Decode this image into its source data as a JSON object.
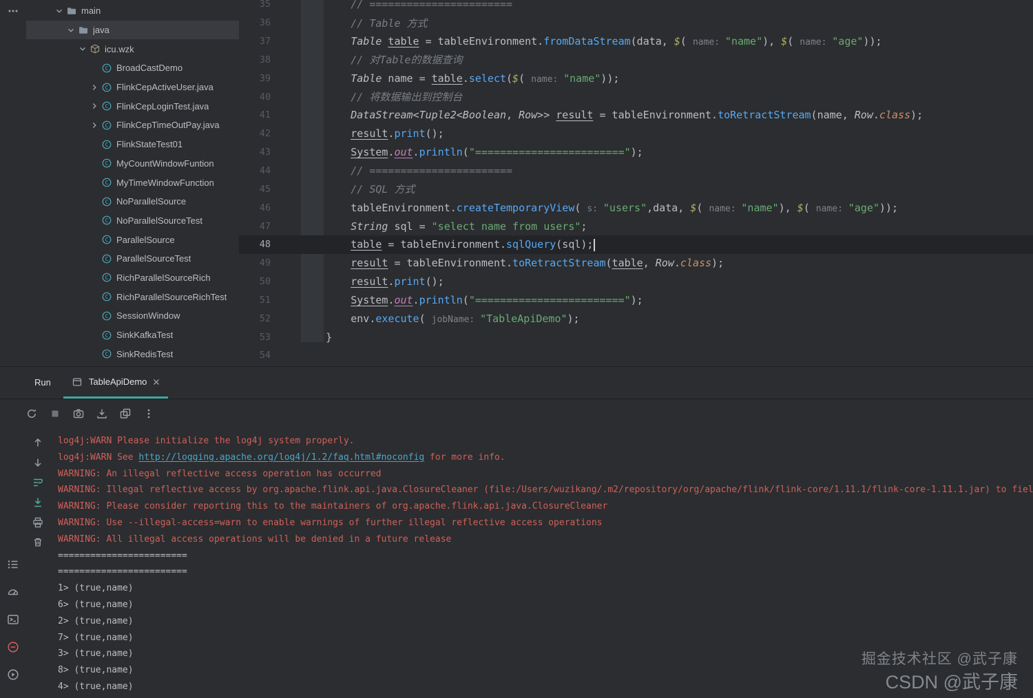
{
  "colors": {
    "background": "#2B2D30",
    "divider": "#1E1F22",
    "selection_bg": "#393B40",
    "caret_line_bg": "#222428",
    "accent_teal": "#3FA99F",
    "stderr_red": "#D0605A",
    "stdout_gray": "#BCBEC4",
    "link_blue": "#4BA6C9",
    "string_green": "#6AAB73",
    "method_blue": "#57A8F5",
    "keyword_orange": "#CF8E6D",
    "comment_gray": "#7A7E85",
    "static_field_purple": "#C77DBB",
    "class_icon_teal": "#4BA8B8",
    "problems_red": "#DB5C5C"
  },
  "left_strip": {
    "top_icons": [
      {
        "name": "more-tool-windows-icon"
      }
    ],
    "bottom_icons": [
      {
        "name": "structure-icon"
      },
      {
        "name": "profiler-icon"
      },
      {
        "name": "terminal-icon"
      },
      {
        "name": "problems-icon"
      },
      {
        "name": "services-icon"
      }
    ]
  },
  "project_tree": {
    "items": [
      {
        "label": "main",
        "type": "folder",
        "depth": 0,
        "chevron": "down"
      },
      {
        "label": "java",
        "type": "folder",
        "depth": 1,
        "chevron": "down",
        "selected": true
      },
      {
        "label": "icu.wzk",
        "type": "package",
        "depth": 2,
        "chevron": "down"
      },
      {
        "label": "BroadCastDemo",
        "type": "class",
        "depth": 3
      },
      {
        "label": "FlinkCepActiveUser.java",
        "type": "class",
        "depth": 3,
        "chevron": "right"
      },
      {
        "label": "FlinkCepLoginTest.java",
        "type": "class",
        "depth": 3,
        "chevron": "right"
      },
      {
        "label": "FlinkCepTimeOutPay.java",
        "type": "class",
        "depth": 3,
        "chevron": "right"
      },
      {
        "label": "FlinkStateTest01",
        "type": "class",
        "depth": 3
      },
      {
        "label": "MyCountWindowFuntion",
        "type": "class",
        "depth": 3
      },
      {
        "label": "MyTimeWindowFunction",
        "type": "class",
        "depth": 3
      },
      {
        "label": "NoParallelSource",
        "type": "class",
        "depth": 3
      },
      {
        "label": "NoParallelSourceTest",
        "type": "class",
        "depth": 3
      },
      {
        "label": "ParallelSource",
        "type": "class",
        "depth": 3
      },
      {
        "label": "ParallelSourceTest",
        "type": "class",
        "depth": 3
      },
      {
        "label": "RichParallelSourceRich",
        "type": "class",
        "depth": 3
      },
      {
        "label": "RichParallelSourceRichTest",
        "type": "class",
        "depth": 3
      },
      {
        "label": "SessionWindow",
        "type": "class",
        "depth": 3
      },
      {
        "label": "SinkKafkaTest",
        "type": "class",
        "depth": 3
      },
      {
        "label": "SinkRedisTest",
        "type": "class",
        "depth": 3
      }
    ]
  },
  "editor": {
    "current_line": 48,
    "lines": [
      {
        "num": 35,
        "ind": 8,
        "tokens": [
          {
            "t": "// =======================",
            "s": "cmt"
          }
        ]
      },
      {
        "num": 36,
        "ind": 8,
        "tokens": [
          {
            "t": "// Table 方式",
            "s": "cmt"
          }
        ]
      },
      {
        "num": 37,
        "ind": 8,
        "tokens": [
          {
            "t": "Table",
            "s": "typ"
          },
          {
            "t": " ",
            "s": "id"
          },
          {
            "t": "table",
            "s": "und"
          },
          {
            "t": " = ",
            "s": "id"
          },
          {
            "t": "tableEnvironment.",
            "s": "id"
          },
          {
            "t": "fromDataStream",
            "s": "mth"
          },
          {
            "t": "(",
            "s": "id"
          },
          {
            "t": "data",
            "s": "id"
          },
          {
            "t": ", ",
            "s": "id"
          },
          {
            "t": "$",
            "s": "smth"
          },
          {
            "t": "( ",
            "s": "id"
          },
          {
            "t": "name: ",
            "s": "hint"
          },
          {
            "t": "\"name\"",
            "s": "str"
          },
          {
            "t": "), ",
            "s": "id"
          },
          {
            "t": "$",
            "s": "smth"
          },
          {
            "t": "( ",
            "s": "id"
          },
          {
            "t": "name: ",
            "s": "hint"
          },
          {
            "t": "\"age\"",
            "s": "str"
          },
          {
            "t": "));",
            "s": "id"
          }
        ]
      },
      {
        "num": 38,
        "ind": 8,
        "tokens": [
          {
            "t": "// 对Table的数据查询",
            "s": "cmt"
          }
        ]
      },
      {
        "num": 39,
        "ind": 8,
        "tokens": [
          {
            "t": "Table",
            "s": "typ"
          },
          {
            "t": " name = ",
            "s": "id"
          },
          {
            "t": "table",
            "s": "und"
          },
          {
            "t": ".",
            "s": "id"
          },
          {
            "t": "select",
            "s": "mth"
          },
          {
            "t": "(",
            "s": "id"
          },
          {
            "t": "$",
            "s": "smth"
          },
          {
            "t": "( ",
            "s": "id"
          },
          {
            "t": "name: ",
            "s": "hint"
          },
          {
            "t": "\"name\"",
            "s": "str"
          },
          {
            "t": "));",
            "s": "id"
          }
        ]
      },
      {
        "num": 40,
        "ind": 8,
        "tokens": [
          {
            "t": "// 将数据输出到控制台",
            "s": "cmt"
          }
        ]
      },
      {
        "num": 41,
        "ind": 8,
        "tokens": [
          {
            "t": "DataStream",
            "s": "typ"
          },
          {
            "t": "<",
            "s": "id"
          },
          {
            "t": "Tuple2",
            "s": "typ"
          },
          {
            "t": "<",
            "s": "id"
          },
          {
            "t": "Boolean",
            "s": "typ"
          },
          {
            "t": ", ",
            "s": "id"
          },
          {
            "t": "Row",
            "s": "typ"
          },
          {
            "t": ">> ",
            "s": "id"
          },
          {
            "t": "result",
            "s": "und"
          },
          {
            "t": " = tableEnvironment.",
            "s": "id"
          },
          {
            "t": "toRetractStream",
            "s": "mth"
          },
          {
            "t": "(",
            "s": "id"
          },
          {
            "t": "name",
            "s": "id"
          },
          {
            "t": ", ",
            "s": "id"
          },
          {
            "t": "Row",
            "s": "typ"
          },
          {
            "t": ".",
            "s": "id"
          },
          {
            "t": "class",
            "s": "kw"
          },
          {
            "t": ");",
            "s": "id"
          }
        ]
      },
      {
        "num": 42,
        "ind": 8,
        "tokens": [
          {
            "t": "result",
            "s": "und"
          },
          {
            "t": ".",
            "s": "id"
          },
          {
            "t": "print",
            "s": "mth"
          },
          {
            "t": "();",
            "s": "id"
          }
        ]
      },
      {
        "num": 43,
        "ind": 8,
        "tokens": [
          {
            "t": "System",
            "s": "und"
          },
          {
            "t": ".",
            "s": "id"
          },
          {
            "t": "out",
            "s": "sfld"
          },
          {
            "t": ".",
            "s": "id"
          },
          {
            "t": "println",
            "s": "mth"
          },
          {
            "t": "(",
            "s": "id"
          },
          {
            "t": "\"========================\"",
            "s": "str"
          },
          {
            "t": ");",
            "s": "id"
          }
        ]
      },
      {
        "num": 44,
        "ind": 8,
        "tokens": [
          {
            "t": "// =======================",
            "s": "cmt"
          }
        ]
      },
      {
        "num": 45,
        "ind": 8,
        "tokens": [
          {
            "t": "// SQL 方式",
            "s": "cmt"
          }
        ]
      },
      {
        "num": 46,
        "ind": 8,
        "tokens": [
          {
            "t": "tableEnvironment.",
            "s": "id"
          },
          {
            "t": "createTemporaryView",
            "s": "mth"
          },
          {
            "t": "( ",
            "s": "id"
          },
          {
            "t": "s: ",
            "s": "hint"
          },
          {
            "t": "\"users\"",
            "s": "str"
          },
          {
            "t": ",",
            "s": "id"
          },
          {
            "t": "data",
            "s": "id"
          },
          {
            "t": ", ",
            "s": "id"
          },
          {
            "t": "$",
            "s": "smth"
          },
          {
            "t": "( ",
            "s": "id"
          },
          {
            "t": "name: ",
            "s": "hint"
          },
          {
            "t": "\"name\"",
            "s": "str"
          },
          {
            "t": "), ",
            "s": "id"
          },
          {
            "t": "$",
            "s": "smth"
          },
          {
            "t": "( ",
            "s": "id"
          },
          {
            "t": "name: ",
            "s": "hint"
          },
          {
            "t": "\"age\"",
            "s": "str"
          },
          {
            "t": "));",
            "s": "id"
          }
        ]
      },
      {
        "num": 47,
        "ind": 8,
        "tokens": [
          {
            "t": "String",
            "s": "typ"
          },
          {
            "t": " sql = ",
            "s": "id"
          },
          {
            "t": "\"select name from users\"",
            "s": "str"
          },
          {
            "t": ";",
            "s": "id"
          }
        ]
      },
      {
        "num": 48,
        "ind": 8,
        "current": true,
        "caret": true,
        "tokens": [
          {
            "t": "table",
            "s": "und"
          },
          {
            "t": " = tableEnvironment.",
            "s": "id"
          },
          {
            "t": "sqlQuery",
            "s": "mth"
          },
          {
            "t": "(",
            "s": "id"
          },
          {
            "t": "sql",
            "s": "id"
          },
          {
            "t": ");",
            "s": "id"
          }
        ]
      },
      {
        "num": 49,
        "ind": 8,
        "tokens": [
          {
            "t": "result",
            "s": "und"
          },
          {
            "t": " = tableEnvironment.",
            "s": "id"
          },
          {
            "t": "toRetractStream",
            "s": "mth"
          },
          {
            "t": "(",
            "s": "id"
          },
          {
            "t": "table",
            "s": "und"
          },
          {
            "t": ", ",
            "s": "id"
          },
          {
            "t": "Row",
            "s": "typ"
          },
          {
            "t": ".",
            "s": "id"
          },
          {
            "t": "class",
            "s": "kw"
          },
          {
            "t": ");",
            "s": "id"
          }
        ]
      },
      {
        "num": 50,
        "ind": 8,
        "tokens": [
          {
            "t": "result",
            "s": "und"
          },
          {
            "t": ".",
            "s": "id"
          },
          {
            "t": "print",
            "s": "mth"
          },
          {
            "t": "();",
            "s": "id"
          }
        ]
      },
      {
        "num": 51,
        "ind": 8,
        "tokens": [
          {
            "t": "System",
            "s": "und"
          },
          {
            "t": ".",
            "s": "id"
          },
          {
            "t": "out",
            "s": "sfld"
          },
          {
            "t": ".",
            "s": "id"
          },
          {
            "t": "println",
            "s": "mth"
          },
          {
            "t": "(",
            "s": "id"
          },
          {
            "t": "\"========================\"",
            "s": "str"
          },
          {
            "t": ");",
            "s": "id"
          }
        ]
      },
      {
        "num": 52,
        "ind": 8,
        "tokens": [
          {
            "t": "env",
            "s": "id"
          },
          {
            "t": ".",
            "s": "id"
          },
          {
            "t": "execute",
            "s": "mth"
          },
          {
            "t": "( ",
            "s": "id"
          },
          {
            "t": "jobName: ",
            "s": "hint"
          },
          {
            "t": "\"TableApiDemo\"",
            "s": "str"
          },
          {
            "t": ");",
            "s": "id"
          }
        ]
      },
      {
        "num": 53,
        "ind": 4,
        "tokens": [
          {
            "t": "}",
            "s": "id"
          }
        ]
      },
      {
        "num": 54,
        "ind": 0,
        "tokens": []
      }
    ]
  },
  "run_panel": {
    "title": "Run",
    "tab": {
      "label": "TableApiDemo",
      "close_label": "×"
    },
    "toolbar_icons": [
      {
        "name": "rerun-icon"
      },
      {
        "name": "stop-icon"
      },
      {
        "name": "screenshot-icon"
      },
      {
        "name": "dump-icon"
      },
      {
        "name": "snapshots-icon"
      },
      {
        "name": "more-options-icon"
      }
    ],
    "gutter_icons": [
      {
        "name": "arrow-up-icon"
      },
      {
        "name": "arrow-down-icon"
      },
      {
        "name": "soft-wrap-icon"
      },
      {
        "name": "scroll-to-end-icon"
      },
      {
        "name": "print-icon"
      },
      {
        "name": "clear-icon"
      }
    ],
    "console_lines": [
      {
        "tokens": [
          {
            "s": "err",
            "t": "log4j:WARN Please initialize the log4j system properly."
          }
        ]
      },
      {
        "tokens": [
          {
            "s": "err",
            "t": "log4j:WARN See "
          },
          {
            "s": "link",
            "t": "http://logging.apache.org/log4j/1.2/faq.html#noconfig"
          },
          {
            "s": "err",
            "t": " for more info."
          }
        ]
      },
      {
        "tokens": [
          {
            "s": "err",
            "t": "WARNING: An illegal reflective access operation has occurred"
          }
        ]
      },
      {
        "tokens": [
          {
            "s": "err",
            "t": "WARNING: Illegal reflective access by org.apache.flink.api.java.ClosureCleaner (file:/Users/wuzikang/.m2/repository/org/apache/flink/flink-core/1.11.1/flink-core-1.11.1.jar) to field java.lang.String value"
          }
        ]
      },
      {
        "tokens": [
          {
            "s": "err",
            "t": "WARNING: Please consider reporting this to the maintainers of org.apache.flink.api.java.ClosureCleaner"
          }
        ]
      },
      {
        "tokens": [
          {
            "s": "err",
            "t": "WARNING: Use --illegal-access=warn to enable warnings of further illegal reflective access operations"
          }
        ]
      },
      {
        "tokens": [
          {
            "s": "err",
            "t": "WARNING: All illegal access operations will be denied in a future release"
          }
        ]
      },
      {
        "tokens": [
          {
            "s": "out",
            "t": "========================"
          }
        ]
      },
      {
        "tokens": [
          {
            "s": "out",
            "t": "========================"
          }
        ]
      },
      {
        "tokens": [
          {
            "s": "out",
            "t": "1> (true,name)"
          }
        ]
      },
      {
        "tokens": [
          {
            "s": "out",
            "t": "6> (true,name)"
          }
        ]
      },
      {
        "tokens": [
          {
            "s": "out",
            "t": "2> (true,name)"
          }
        ]
      },
      {
        "tokens": [
          {
            "s": "out",
            "t": "7> (true,name)"
          }
        ]
      },
      {
        "tokens": [
          {
            "s": "out",
            "t": "3> (true,name)"
          }
        ]
      },
      {
        "tokens": [
          {
            "s": "out",
            "t": "8> (true,name)"
          }
        ]
      },
      {
        "tokens": [
          {
            "s": "out",
            "t": "4> (true,name)"
          }
        ]
      }
    ]
  },
  "watermark": {
    "line1": "掘金技术社区 @武子康",
    "line2": "CSDN @武子康"
  }
}
